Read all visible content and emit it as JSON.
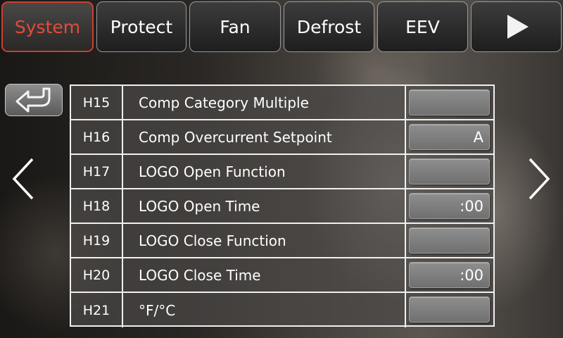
{
  "tabs": [
    {
      "label": "System",
      "active": true
    },
    {
      "label": "Protect",
      "active": false
    },
    {
      "label": "Fan",
      "active": false
    },
    {
      "label": "Defrost",
      "active": false
    },
    {
      "label": "EEV",
      "active": false
    }
  ],
  "next_tab_icon": "play-icon",
  "back_icon": "return-arrow-icon",
  "nav": {
    "prev_icon": "chevron-left-icon",
    "next_icon": "chevron-right-icon"
  },
  "colors": {
    "active_tab_text": "#e24b3b",
    "active_tab_border": "#c9402f"
  },
  "params": [
    {
      "code": "H15",
      "name": "Comp Category Multiple",
      "value": ""
    },
    {
      "code": "H16",
      "name": "Comp Overcurrent Setpoint",
      "value": "A"
    },
    {
      "code": "H17",
      "name": "LOGO Open Function",
      "value": ""
    },
    {
      "code": "H18",
      "name": "LOGO Open Time",
      "value": ":00"
    },
    {
      "code": "H19",
      "name": "LOGO Close Function",
      "value": ""
    },
    {
      "code": "H20",
      "name": "LOGO Close Time",
      "value": ":00"
    },
    {
      "code": "H21",
      "name": "°F/°C",
      "value": ""
    }
  ]
}
